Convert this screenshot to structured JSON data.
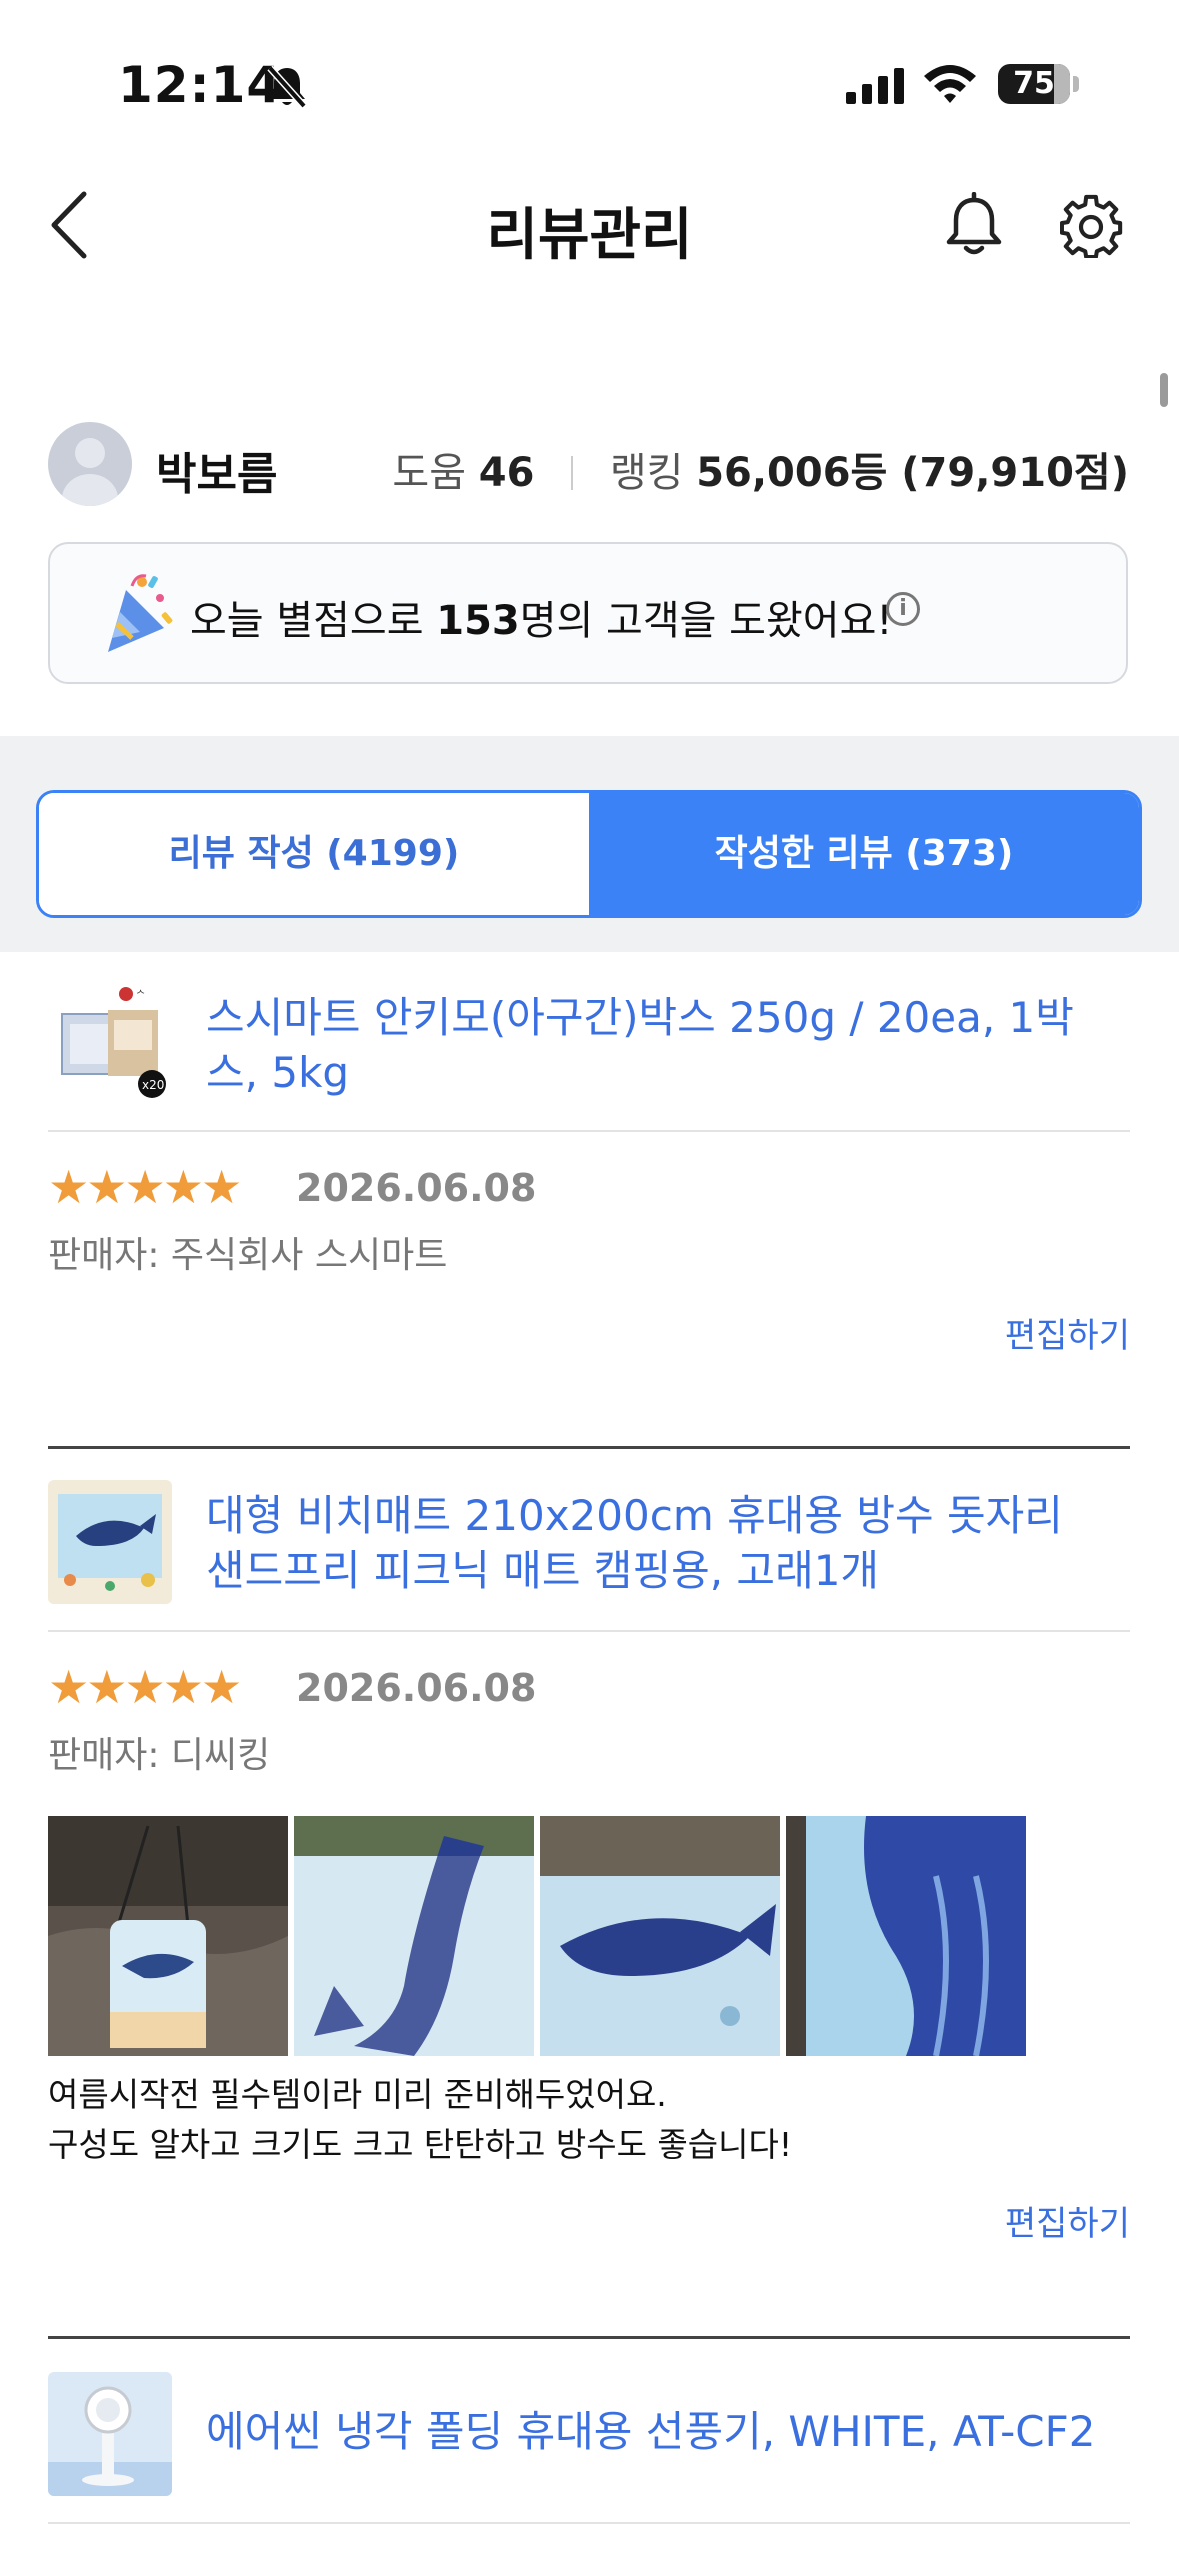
{
  "status": {
    "time": "12:14",
    "battery": "75"
  },
  "header": {
    "title": "리뷰관리"
  },
  "profile": {
    "name": "박보름",
    "help_label": "도움",
    "help_count": "46",
    "ranking_label": "랭킹",
    "ranking_value": "56,006등 (79,910점)"
  },
  "banner": {
    "prefix": "오늘 별점으로 ",
    "count": "153",
    "suffix": "명의 고객을 도왔어요!"
  },
  "tabs": [
    {
      "label": "리뷰 작성 (4199)",
      "active": false
    },
    {
      "label": "작성한 리뷰 (373)",
      "active": true
    }
  ],
  "reviews": [
    {
      "product": "스시마트 안키모(아구간)박스 250g / 20ea, 1박스, 5kg",
      "stars": "★★★★★",
      "date": "2026.06.08",
      "seller": "판매자: 주식회사 스시마트",
      "edit": "편집하기"
    },
    {
      "product": "대형 비치매트 210x200cm 휴대용 방수 돗자리 샌드프리 피크닉 매트 캠핑용, 고래1개",
      "stars": "★★★★★",
      "date": "2026.06.08",
      "seller": "판매자: 디씨킹",
      "text_line1": "여름시작전 필수템이라 미리 준비해두었어요.",
      "text_line2": "구성도 알차고 크기도 크고 탄탄하고 방수도 좋습니다!",
      "edit": "편집하기"
    },
    {
      "product": "에어씬 냉각 폴딩 휴대용 선풍기, WHITE, AT-CF2"
    }
  ],
  "colors": {
    "accent": "#3b82f6",
    "link": "#3a6fe0",
    "star": "#f09c3a"
  }
}
